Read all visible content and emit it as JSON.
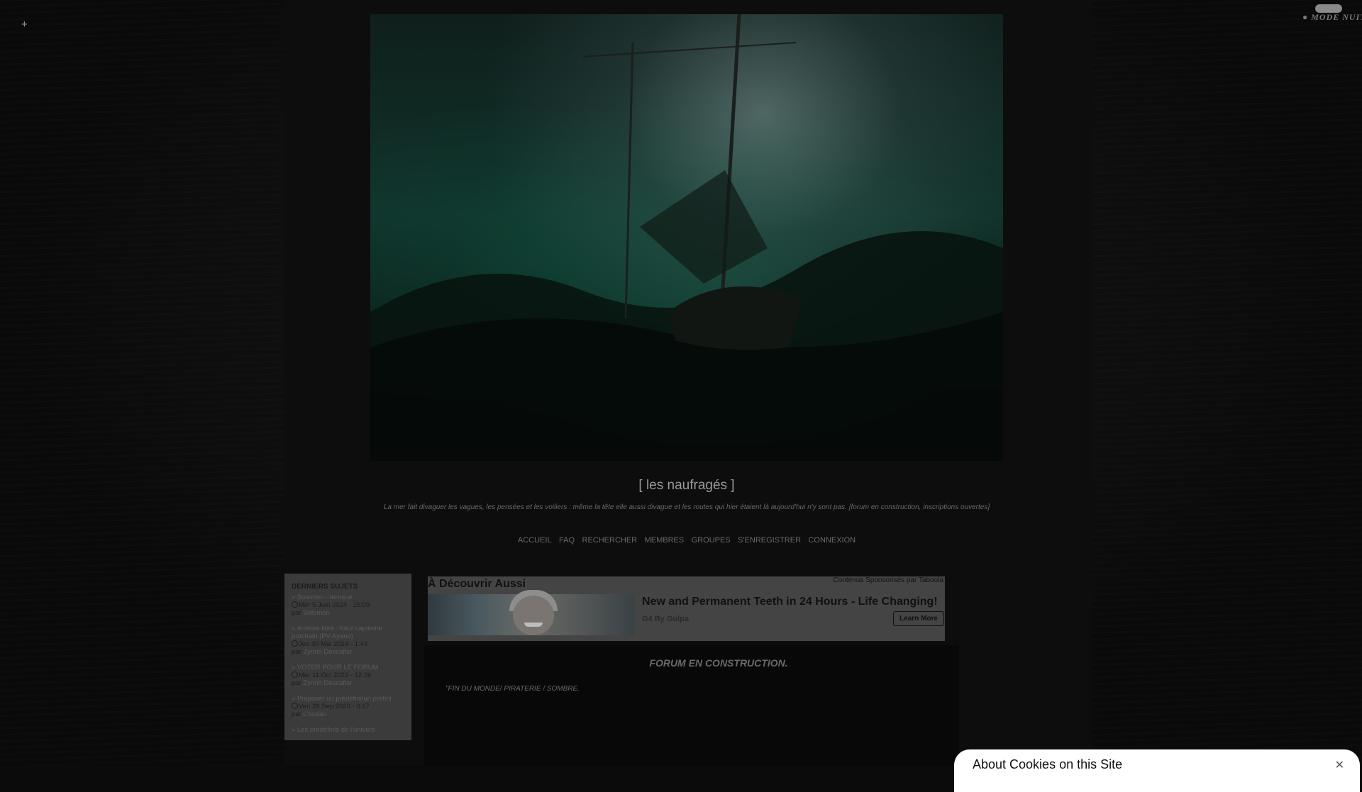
{
  "top": {
    "plus": "+",
    "mode_label": "MODE NUIT"
  },
  "header": {
    "title": "[ les naufragés ]",
    "tagline": "La mer fait divaguer les vagues, les pensées et les voiliers : même la tête elle aussi divague et les routes qui hier étaient là aujourd'hui n'y sont pas. [forum en construction, inscriptions ouvertes]"
  },
  "nav": {
    "items": [
      "ACCUEIL",
      "FAQ",
      "RECHERCHER",
      "MEMBRES",
      "GROUPES",
      "S'ENREGISTRER",
      "CONNEXION"
    ]
  },
  "sidebar": {
    "heading": "DERNIERS SUJETS",
    "topics": [
      {
        "title": "Solomon - terminé",
        "date": "Mer 5 Juin 2024 - 15:09",
        "by": "par",
        "author": "Solomon"
      },
      {
        "title": "écriture libre : futur capitaine prochain (PV Ayano)",
        "date": "Jeu 30 Mai 2024 - 1:43",
        "by": "par",
        "author": "Zyrinh Descafier"
      },
      {
        "title": "VOTER POUR LE FORUM",
        "date": "Mer 11 Oct 2023 - 12:26",
        "by": "par",
        "author": "Zyrinh Descafier"
      },
      {
        "title": "Proposer un prédéfini/un préfini",
        "date": "Ven 29 Sep 2023 - 0:17",
        "by": "par",
        "author": "L'océan"
      },
      {
        "title": "Les prédéfinis de l'univers",
        "date": "",
        "by": "",
        "author": ""
      }
    ]
  },
  "promo": {
    "heading": "À Découvrir Aussi",
    "sponsor": "Contenus Sponsorisés par Taboola",
    "title": "New and Permanent Teeth in 24 Hours - Life Changing!",
    "source": "G4 By Golpa",
    "button": "Learn More"
  },
  "main": {
    "construction": "FORUM EN CONSTRUCTION.",
    "genre": "\"FIN DU MONDE/ PIRATERIE / SOMBRE."
  },
  "cookie": {
    "title": "About Cookies on this Site",
    "close": "✕"
  }
}
